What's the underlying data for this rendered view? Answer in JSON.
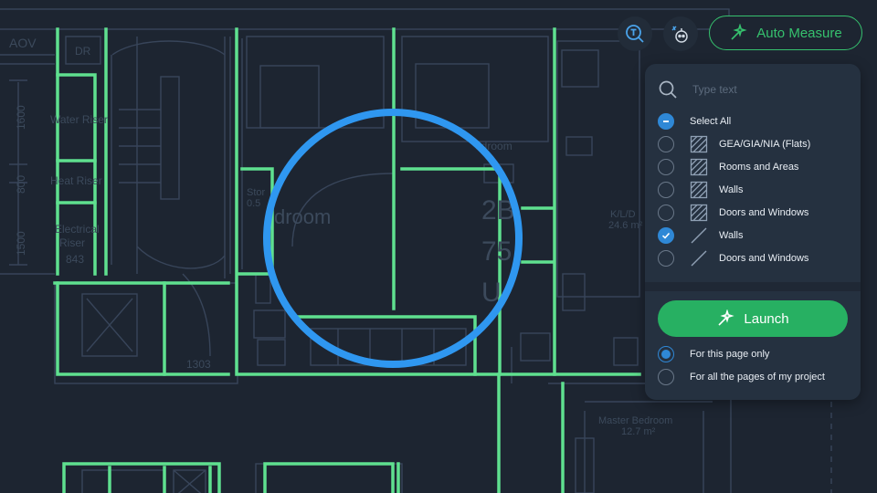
{
  "floor_plan": {
    "labels": {
      "aov": "AOV",
      "dr": "DR",
      "water_riser": "Water Riser",
      "heat_riser": "Heat Riser",
      "electrical_riser_1": "Electrical",
      "electrical_riser_2": "Riser",
      "riser_num": "843",
      "dim_1600": "1600",
      "dim_800": "800",
      "dim_1500": "1500",
      "storage_1": "Stor",
      "storage_2": "0.5",
      "bedroom_left": "droom",
      "bedroom_right": "edroom",
      "flat_code_1": "2B",
      "flat_code_2": "75",
      "flat_code_3": "U",
      "kld_name": "K/L/D",
      "kld_area": "24.6 m²",
      "dim_1303": "1303",
      "master_bedroom_name": "Master Bedroom",
      "master_bedroom_area": "12.7 m²"
    }
  },
  "toolbar": {
    "auto_measure_label": "Auto Measure"
  },
  "panel": {
    "search_placeholder": "Type text",
    "select_all_label": "Select All",
    "items": [
      {
        "label": "GEA/GIA/NIA (Flats)",
        "checked": false,
        "icon": "hatched-area-icon"
      },
      {
        "label": "Rooms and Areas",
        "checked": false,
        "icon": "hatched-area-icon"
      },
      {
        "label": "Walls",
        "checked": false,
        "icon": "hatched-area-icon"
      },
      {
        "label": "Doors and Windows",
        "checked": false,
        "icon": "hatched-area-icon"
      },
      {
        "label": "Walls",
        "checked": true,
        "icon": "line-icon"
      },
      {
        "label": "Doors and Windows",
        "checked": false,
        "icon": "line-icon"
      }
    ],
    "launch_label": "Launch",
    "scope_options": [
      {
        "label": "For this page only",
        "selected": true
      },
      {
        "label": "For all the pages of my project",
        "selected": false
      }
    ]
  },
  "colors": {
    "background": "#1d2531",
    "wall_highlight": "#5fe08f",
    "accent_blue": "#2f88d6",
    "accent_green": "#27b062",
    "focus_ring": "#2f97f0"
  }
}
